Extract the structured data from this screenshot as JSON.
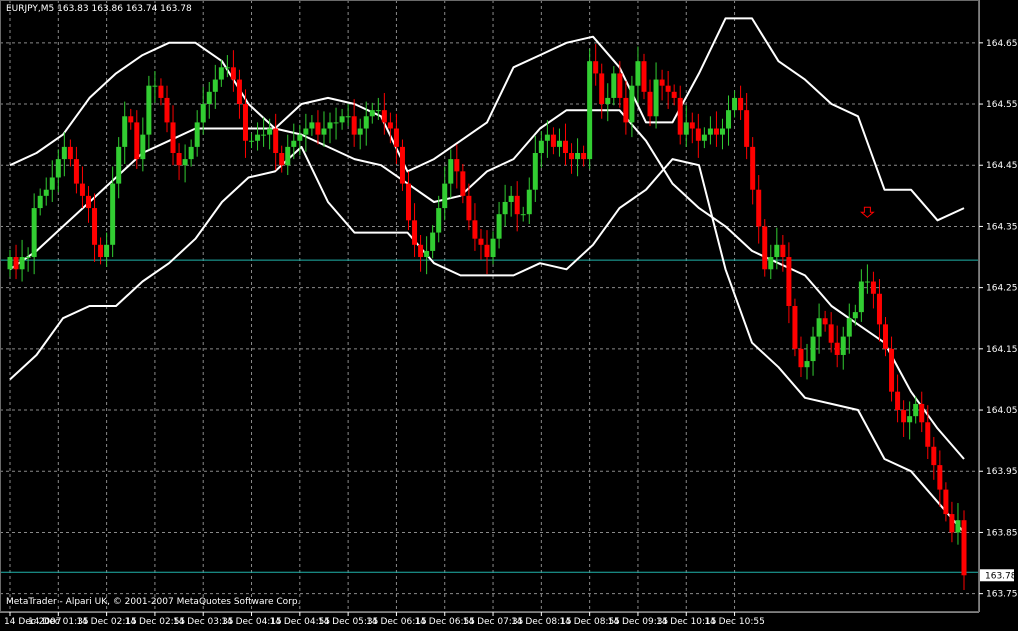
{
  "window": {
    "symbol_title": "EURJPY,M5  163.83 163.86 163.74 163.78",
    "copyright": "MetaTrader - Alpari UK, © 2001-2007 MetaQuotes Software Corp."
  },
  "colors": {
    "background": "#000000",
    "grid": "#8a8a8a",
    "bull": "#32cd32",
    "bear": "#ff0000",
    "band": "#ffffff",
    "hline": "#20b2aa",
    "current_price_box": "#ffffff"
  },
  "chart_data": {
    "type": "candlestick",
    "title": "EURJPY,M5",
    "ylim": [
      163.72,
      164.72
    ],
    "grid": true,
    "price_ticks": [
      "164.65",
      "164.55",
      "164.45",
      "164.35",
      "164.25",
      "164.15",
      "164.05",
      "163.95",
      "163.85",
      "163.75"
    ],
    "time_ticks": [
      "14 Dec 2007",
      "14 Dec 01:35",
      "14 Dec 02:15",
      "14 Dec 02:55",
      "14 Dec 03:35",
      "14 Dec 04:15",
      "14 Dec 04:55",
      "14 Dec 05:35",
      "14 Dec 06:15",
      "14 Dec 06:55",
      "14 Dec 07:35",
      "14 Dec 08:15",
      "14 Dec 08:55",
      "14 Dec 09:35",
      "14 Dec 10:15",
      "14 Dec 10:55"
    ],
    "horizontal_lines": [
      164.295,
      163.785
    ],
    "current_price": "163.78",
    "arrow_marker": {
      "index": 142,
      "price": 164.365
    },
    "close": [
      164.3,
      164.28,
      164.3,
      164.3,
      164.38,
      164.4,
      164.41,
      164.43,
      164.46,
      164.48,
      164.46,
      164.42,
      164.4,
      164.38,
      164.32,
      164.3,
      164.32,
      164.42,
      164.48,
      164.53,
      164.52,
      164.46,
      164.5,
      164.58,
      164.58,
      164.56,
      164.52,
      164.47,
      164.45,
      164.46,
      164.48,
      164.52,
      164.55,
      164.57,
      164.59,
      164.61,
      164.61,
      164.59,
      164.55,
      164.49,
      164.49,
      164.5,
      164.5,
      164.51,
      164.47,
      164.45,
      164.48,
      164.49,
      164.5,
      164.51,
      164.52,
      164.5,
      164.51,
      164.52,
      164.52,
      164.53,
      164.53,
      164.5,
      164.51,
      164.53,
      164.54,
      164.54,
      164.52,
      164.51,
      164.48,
      164.42,
      164.36,
      164.32,
      164.3,
      164.31,
      164.34,
      164.38,
      164.42,
      164.46,
      164.44,
      164.4,
      164.36,
      164.33,
      164.32,
      164.3,
      164.33,
      164.37,
      164.39,
      164.4,
      164.37,
      164.37,
      164.41,
      164.47,
      164.49,
      164.5,
      164.48,
      164.49,
      164.47,
      164.46,
      164.47,
      164.46,
      164.62,
      164.6,
      164.55,
      164.56,
      164.6,
      164.56,
      164.52,
      164.58,
      164.62,
      164.57,
      164.53,
      164.59,
      164.58,
      164.57,
      164.56,
      164.5,
      164.52,
      164.51,
      164.49,
      164.5,
      164.51,
      164.5,
      164.51,
      164.54,
      164.56,
      164.54,
      164.48,
      164.41,
      164.35,
      164.28,
      164.3,
      164.32,
      164.3,
      164.22,
      164.15,
      164.12,
      164.13,
      164.17,
      164.2,
      164.19,
      164.16,
      164.14,
      164.17,
      164.2,
      164.21,
      164.26,
      164.26,
      164.24,
      164.19,
      164.15,
      164.08,
      164.05,
      164.03,
      164.04,
      164.06,
      164.03,
      163.99,
      163.96,
      163.92,
      163.88,
      163.85,
      163.87,
      163.78
    ],
    "bollinger": {
      "upper": [
        164.45,
        164.47,
        164.5,
        164.56,
        164.6,
        164.63,
        164.65,
        164.65,
        164.62,
        164.55,
        164.51,
        164.55,
        164.56,
        164.55,
        164.53,
        164.44,
        164.46,
        164.49,
        164.52,
        164.61,
        164.63,
        164.65,
        164.66,
        164.61,
        164.52,
        164.52,
        164.6,
        164.69,
        164.69,
        164.62,
        164.59,
        164.55,
        164.53,
        164.41,
        164.41,
        164.36,
        164.38
      ],
      "middle": [
        164.28,
        164.31,
        164.35,
        164.39,
        164.43,
        164.47,
        164.49,
        164.51,
        164.51,
        164.51,
        164.51,
        164.5,
        164.48,
        164.46,
        164.45,
        164.42,
        164.39,
        164.4,
        164.44,
        164.46,
        164.51,
        164.54,
        164.54,
        164.54,
        164.49,
        164.42,
        164.38,
        164.35,
        164.31,
        164.29,
        164.27,
        164.22,
        164.19,
        164.16,
        164.08,
        164.02,
        163.97
      ],
      "lower": [
        164.1,
        164.14,
        164.2,
        164.22,
        164.22,
        164.26,
        164.29,
        164.33,
        164.39,
        164.43,
        164.44,
        164.48,
        164.39,
        164.34,
        164.34,
        164.34,
        164.29,
        164.27,
        164.27,
        164.27,
        164.29,
        164.28,
        164.32,
        164.38,
        164.41,
        164.46,
        164.45,
        164.28,
        164.16,
        164.12,
        164.07,
        164.06,
        164.05,
        163.97,
        163.95,
        163.9,
        163.85
      ]
    }
  }
}
